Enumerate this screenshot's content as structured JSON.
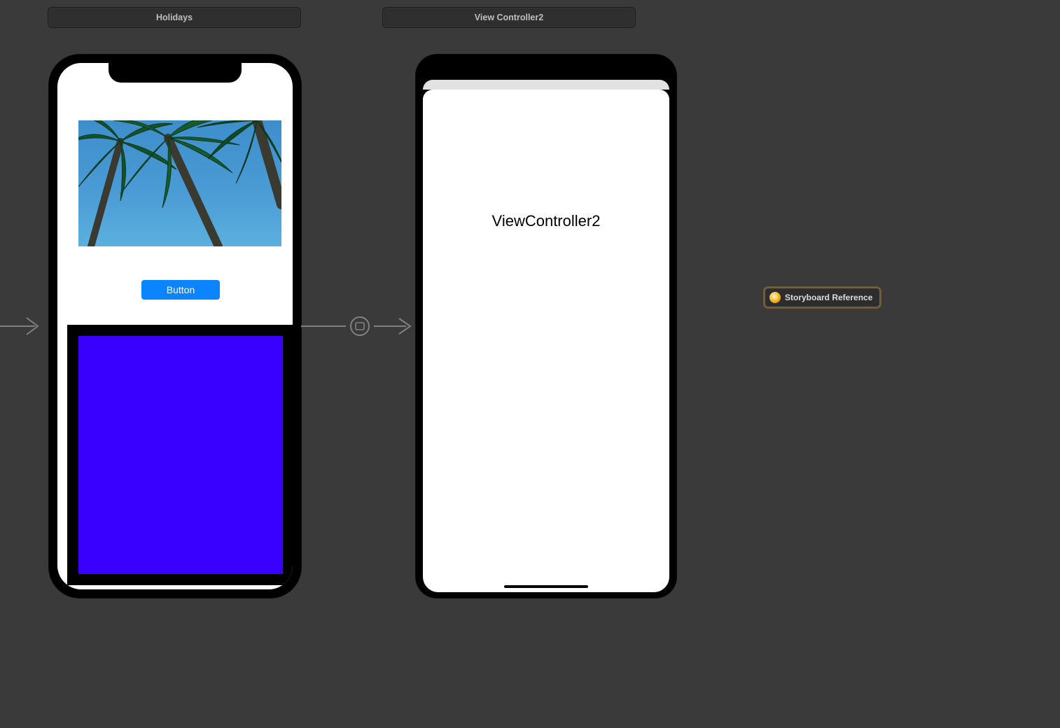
{
  "scenes": {
    "scene1_title": "Holidays",
    "scene2_title": "View Controller2"
  },
  "scene1": {
    "button_label": "Button"
  },
  "scene2": {
    "label_text": "ViewController2"
  },
  "storyboard_reference": {
    "label": "Storyboard Reference"
  },
  "colors": {
    "canvas_bg": "#3a3a3a",
    "title_bg": "#2f2f2f",
    "button_bg": "#0a84ff",
    "container_inner": "#3900ff"
  }
}
